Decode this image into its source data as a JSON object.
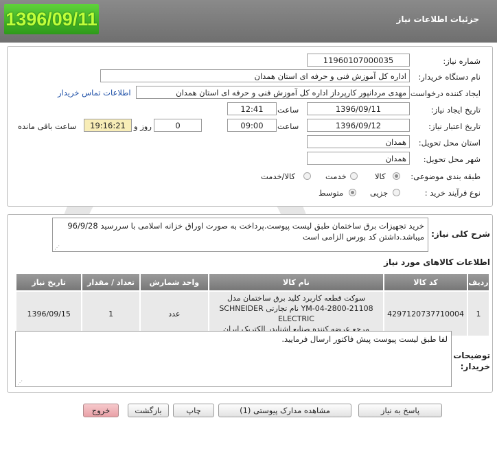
{
  "header": {
    "date": "1396/09/11",
    "title": "جزئیات اطلاعات نیاز"
  },
  "form": {
    "need_number_label": "شماره نیاز:",
    "need_number": "11960107000035",
    "buyer_org_label": "نام دستگاه خریدار:",
    "buyer_org": "اداره کل آموزش فنی و حرفه ای استان همدان",
    "requester_label": "ایجاد کننده درخواست:",
    "requester": "مهدی مردانپور کارپرداز اداره کل آموزش فنی و حرفه ای استان همدان",
    "contact_link": "اطلاعات تماس خریدار",
    "created_label": "تاریخ ایجاد نیاز:",
    "created_date": "1396/09/11",
    "time_word": "ساعت",
    "created_time": "12:41",
    "validity_label": "تاریخ اعتبار نیاز:",
    "validity_date": "1396/09/12",
    "validity_time": "09:00",
    "days_remaining": "0",
    "day_and_word": "روز و",
    "time_remaining": "19:16:21",
    "time_remaining_suffix": "ساعت باقی مانده",
    "province_label": "استان محل تحویل:",
    "province": "همدان",
    "city_label": "شهر محل تحویل:",
    "city": "همدان",
    "category_label": "طبقه بندی موضوعی:",
    "category_options": [
      "کالا",
      "خدمت",
      "کالا/خدمت"
    ],
    "category_selected": "کالا",
    "process_label": "نوع فرآیند خرید :",
    "process_options": [
      "جزیی",
      "متوسط"
    ],
    "process_selected": "متوسط"
  },
  "description": {
    "label": "شرح کلی نیاز:",
    "text": "خرید تجهیزات برق ساختمان طبق لیست پیوست.پرداخت به صورت اوراق خزانه اسلامی با سررسید 96/9/28 میباشد.داشتن کد بورس الزامی است"
  },
  "goods": {
    "title": "اطلاعات کالاهای مورد نیاز",
    "headers": [
      "ردیف",
      "کد کالا",
      "نام کالا",
      "واحد شمارش",
      "تعداد / مقدار",
      "تاریخ نیاز"
    ],
    "rows": [
      {
        "row": "1",
        "code": "4297120737710004",
        "name_lines": [
          "سوکت قطعه کاربرد کلید برق ساختمان مدل",
          "YM-04-2800-21108 نام تجارتی SCHNEIDER ELECTRIC",
          "مرجع عرضه کننده صنایع اشنایدر الکتریک ایران"
        ],
        "unit": "عدد",
        "qty": "1",
        "need_date": "1396/09/15"
      }
    ]
  },
  "buyer_notes": {
    "label_line1": "توضیحات",
    "label_line2": "خریدار:",
    "text": "لفا طبق لیست پیوست پیش فاکتور ارسال فرمایید."
  },
  "buttons": {
    "reply": "پاسخ به نیاز",
    "attachments": "مشاهده مدارک پیوستی (1)",
    "print": "چاپ",
    "back": "بازگشت",
    "exit": "خروج"
  },
  "colors": {
    "header_bg": "#7d7d7d",
    "date_badge": "#3fb227",
    "table_header": "#888888",
    "remaining_bg": "#f8edb7",
    "exit_button": "#eeb3b8",
    "link": "#1d4fa7"
  }
}
